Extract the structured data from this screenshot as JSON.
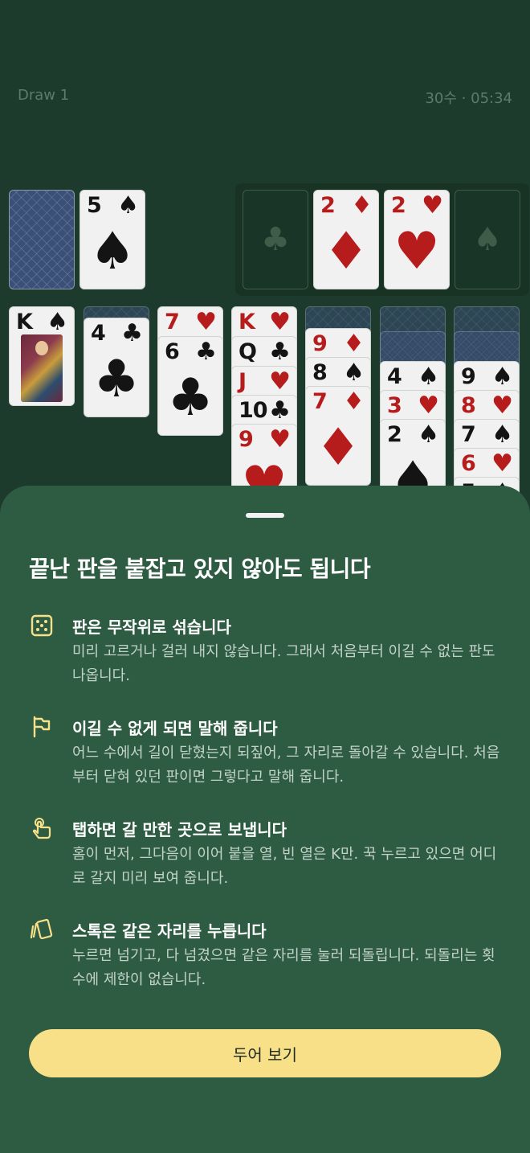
{
  "header": {
    "mode": "Draw 1",
    "status": "30수 · 05:34"
  },
  "colors": {
    "felt": "#1d3b2c",
    "sheet": "#2e5c43",
    "accent": "#f8e089",
    "red_suit": "#b71c1c"
  },
  "cards": {
    "waste_top": {
      "rank": "5",
      "suit": "♠"
    },
    "foundations": [
      {
        "rank": "",
        "suit": "♣"
      },
      {
        "rank": "2",
        "suit": "♦"
      },
      {
        "rank": "2",
        "suit": "♥"
      },
      {
        "rank": "",
        "suit": "♠"
      }
    ],
    "tableau": [
      [
        {
          "rank": "K",
          "suit": "♠"
        }
      ],
      [
        {
          "rank": "4",
          "suit": "♣"
        }
      ],
      [
        {
          "rank": "7",
          "suit": "♥"
        },
        {
          "rank": "6",
          "suit": "♣"
        }
      ],
      [
        {
          "rank": "K",
          "suit": "♥"
        },
        {
          "rank": "Q",
          "suit": "♣"
        },
        {
          "rank": "J",
          "suit": "♥"
        },
        {
          "rank": "10",
          "suit": "♣"
        },
        {
          "rank": "9",
          "suit": "♥"
        }
      ],
      [
        {
          "rank": "9",
          "suit": "♦"
        },
        {
          "rank": "8",
          "suit": "♠"
        },
        {
          "rank": "7",
          "suit": "♦"
        }
      ],
      [
        {
          "rank": "4",
          "suit": "♠"
        },
        {
          "rank": "3",
          "suit": "♥"
        },
        {
          "rank": "2",
          "suit": "♠"
        }
      ],
      [
        {
          "rank": "9",
          "suit": "♠"
        },
        {
          "rank": "8",
          "suit": "♥"
        },
        {
          "rank": "7",
          "suit": "♠"
        },
        {
          "rank": "6",
          "suit": "♥"
        },
        {
          "rank": "5",
          "suit": "♠"
        }
      ]
    ]
  },
  "sheet": {
    "title": "끝난 판을 붙잡고 있지 않아도 됩니다",
    "tips": [
      {
        "icon": "dice-icon",
        "title": "판은 무작위로 섞습니다",
        "desc": "미리 고르거나 걸러 내지 않습니다. 그래서 처음부터 이길 수 없는 판도 나옵니다."
      },
      {
        "icon": "flag-icon",
        "title": "이길 수 없게 되면 말해 줍니다",
        "desc": "어느 수에서 길이 닫혔는지 되짚어, 그 자리로 돌아갈 수 있습니다. 처음부터 닫혀 있던 판이면 그렇다고 말해 줍니다."
      },
      {
        "icon": "tap-hand-icon",
        "title": "탭하면 갈 만한 곳으로 보냅니다",
        "desc": "홈이 먼저, 그다음이 이어 붙을 열, 빈 열은 K만. 꾹 누르고 있으면 어디로 갈지 미리 보여 줍니다."
      },
      {
        "icon": "card-stack-icon",
        "title": "스톡은 같은 자리를 누릅니다",
        "desc": "누르면 넘기고, 다 넘겼으면 같은 자리를 눌러 되돌립니다. 되돌리는 횟수에 제한이 없습니다."
      }
    ],
    "cta_label": "두어 보기"
  }
}
